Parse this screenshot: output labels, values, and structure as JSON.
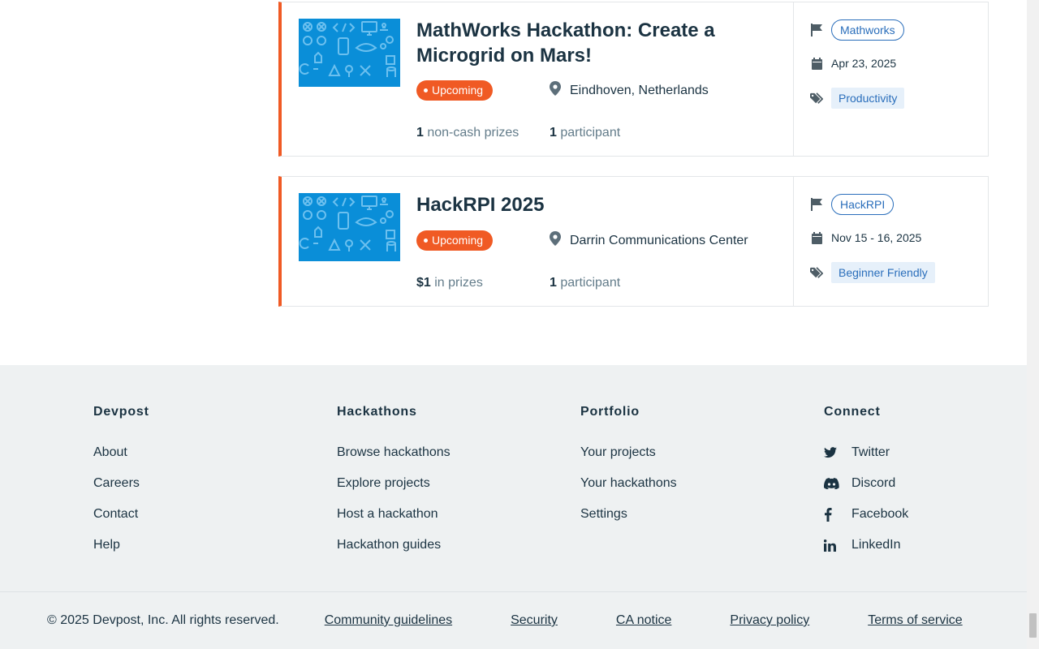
{
  "hackathons": [
    {
      "title": "MathWorks Hackathon: Create a Microgrid on Mars!",
      "status": "Upcoming",
      "location": "Eindhoven, Netherlands",
      "prizes_value": "1",
      "prizes_label": " non-cash prizes",
      "participants_value": "1",
      "participants_label": " participant",
      "host": "Mathworks",
      "dates": "Apr 23, 2025",
      "theme": "Productivity"
    },
    {
      "title": "HackRPI 2025",
      "status": "Upcoming",
      "location": "Darrin Communications Center",
      "prizes_value": "$1",
      "prizes_label": " in prizes",
      "participants_value": "1",
      "participants_label": " participant",
      "host": "HackRPI",
      "dates": "Nov 15 - 16, 2025",
      "theme": "Beginner Friendly"
    }
  ],
  "footer": {
    "columns": [
      {
        "heading": "Devpost",
        "links": [
          "About",
          "Careers",
          "Contact",
          "Help"
        ]
      },
      {
        "heading": "Hackathons",
        "links": [
          "Browse hackathons",
          "Explore projects",
          "Host a hackathon",
          "Hackathon guides"
        ]
      },
      {
        "heading": "Portfolio",
        "links": [
          "Your projects",
          "Your hackathons",
          "Settings"
        ]
      },
      {
        "heading": "Connect",
        "links": [
          "Twitter",
          "Discord",
          "Facebook",
          "LinkedIn"
        ]
      }
    ],
    "copyright": "© 2025 Devpost, Inc. All rights reserved.",
    "legal_links": [
      "Community guidelines",
      "Security",
      "CA notice",
      "Privacy policy",
      "Terms of service"
    ]
  },
  "icons": {
    "flag": "flag-icon",
    "calendar": "calendar-icon",
    "tags": "tags-icon",
    "location": "map-pin-icon",
    "twitter": "twitter-icon",
    "discord": "discord-icon",
    "facebook": "facebook-icon",
    "linkedin": "linkedin-icon"
  },
  "colors": {
    "accent": "#f05a24",
    "link_blue": "#2a6ebb",
    "thumb_blue": "#0a8ed8",
    "text": "#1b3342",
    "footer_bg": "#eef1f2"
  }
}
